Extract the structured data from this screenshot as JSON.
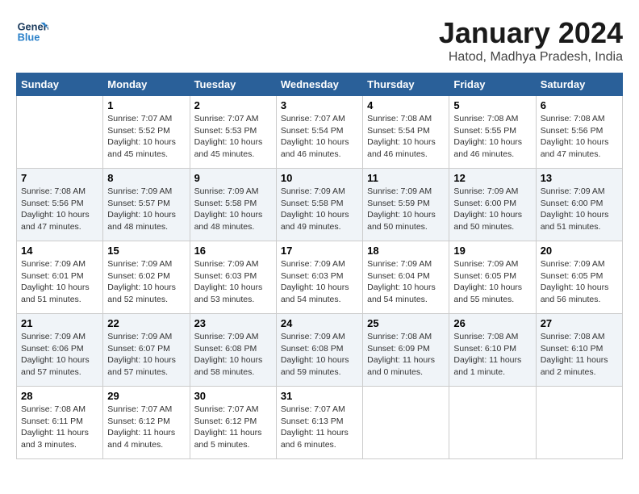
{
  "header": {
    "logo_line1": "General",
    "logo_line2": "Blue",
    "month_title": "January 2024",
    "location": "Hatod, Madhya Pradesh, India"
  },
  "days_of_week": [
    "Sunday",
    "Monday",
    "Tuesday",
    "Wednesday",
    "Thursday",
    "Friday",
    "Saturday"
  ],
  "weeks": [
    [
      {
        "day": "",
        "info": ""
      },
      {
        "day": "1",
        "info": "Sunrise: 7:07 AM\nSunset: 5:52 PM\nDaylight: 10 hours\nand 45 minutes."
      },
      {
        "day": "2",
        "info": "Sunrise: 7:07 AM\nSunset: 5:53 PM\nDaylight: 10 hours\nand 45 minutes."
      },
      {
        "day": "3",
        "info": "Sunrise: 7:07 AM\nSunset: 5:54 PM\nDaylight: 10 hours\nand 46 minutes."
      },
      {
        "day": "4",
        "info": "Sunrise: 7:08 AM\nSunset: 5:54 PM\nDaylight: 10 hours\nand 46 minutes."
      },
      {
        "day": "5",
        "info": "Sunrise: 7:08 AM\nSunset: 5:55 PM\nDaylight: 10 hours\nand 46 minutes."
      },
      {
        "day": "6",
        "info": "Sunrise: 7:08 AM\nSunset: 5:56 PM\nDaylight: 10 hours\nand 47 minutes."
      }
    ],
    [
      {
        "day": "7",
        "info": "Sunrise: 7:08 AM\nSunset: 5:56 PM\nDaylight: 10 hours\nand 47 minutes."
      },
      {
        "day": "8",
        "info": "Sunrise: 7:09 AM\nSunset: 5:57 PM\nDaylight: 10 hours\nand 48 minutes."
      },
      {
        "day": "9",
        "info": "Sunrise: 7:09 AM\nSunset: 5:58 PM\nDaylight: 10 hours\nand 48 minutes."
      },
      {
        "day": "10",
        "info": "Sunrise: 7:09 AM\nSunset: 5:58 PM\nDaylight: 10 hours\nand 49 minutes."
      },
      {
        "day": "11",
        "info": "Sunrise: 7:09 AM\nSunset: 5:59 PM\nDaylight: 10 hours\nand 50 minutes."
      },
      {
        "day": "12",
        "info": "Sunrise: 7:09 AM\nSunset: 6:00 PM\nDaylight: 10 hours\nand 50 minutes."
      },
      {
        "day": "13",
        "info": "Sunrise: 7:09 AM\nSunset: 6:00 PM\nDaylight: 10 hours\nand 51 minutes."
      }
    ],
    [
      {
        "day": "14",
        "info": "Sunrise: 7:09 AM\nSunset: 6:01 PM\nDaylight: 10 hours\nand 51 minutes."
      },
      {
        "day": "15",
        "info": "Sunrise: 7:09 AM\nSunset: 6:02 PM\nDaylight: 10 hours\nand 52 minutes."
      },
      {
        "day": "16",
        "info": "Sunrise: 7:09 AM\nSunset: 6:03 PM\nDaylight: 10 hours\nand 53 minutes."
      },
      {
        "day": "17",
        "info": "Sunrise: 7:09 AM\nSunset: 6:03 PM\nDaylight: 10 hours\nand 54 minutes."
      },
      {
        "day": "18",
        "info": "Sunrise: 7:09 AM\nSunset: 6:04 PM\nDaylight: 10 hours\nand 54 minutes."
      },
      {
        "day": "19",
        "info": "Sunrise: 7:09 AM\nSunset: 6:05 PM\nDaylight: 10 hours\nand 55 minutes."
      },
      {
        "day": "20",
        "info": "Sunrise: 7:09 AM\nSunset: 6:05 PM\nDaylight: 10 hours\nand 56 minutes."
      }
    ],
    [
      {
        "day": "21",
        "info": "Sunrise: 7:09 AM\nSunset: 6:06 PM\nDaylight: 10 hours\nand 57 minutes."
      },
      {
        "day": "22",
        "info": "Sunrise: 7:09 AM\nSunset: 6:07 PM\nDaylight: 10 hours\nand 57 minutes."
      },
      {
        "day": "23",
        "info": "Sunrise: 7:09 AM\nSunset: 6:08 PM\nDaylight: 10 hours\nand 58 minutes."
      },
      {
        "day": "24",
        "info": "Sunrise: 7:09 AM\nSunset: 6:08 PM\nDaylight: 10 hours\nand 59 minutes."
      },
      {
        "day": "25",
        "info": "Sunrise: 7:08 AM\nSunset: 6:09 PM\nDaylight: 11 hours\nand 0 minutes."
      },
      {
        "day": "26",
        "info": "Sunrise: 7:08 AM\nSunset: 6:10 PM\nDaylight: 11 hours\nand 1 minute."
      },
      {
        "day": "27",
        "info": "Sunrise: 7:08 AM\nSunset: 6:10 PM\nDaylight: 11 hours\nand 2 minutes."
      }
    ],
    [
      {
        "day": "28",
        "info": "Sunrise: 7:08 AM\nSunset: 6:11 PM\nDaylight: 11 hours\nand 3 minutes."
      },
      {
        "day": "29",
        "info": "Sunrise: 7:07 AM\nSunset: 6:12 PM\nDaylight: 11 hours\nand 4 minutes."
      },
      {
        "day": "30",
        "info": "Sunrise: 7:07 AM\nSunset: 6:12 PM\nDaylight: 11 hours\nand 5 minutes."
      },
      {
        "day": "31",
        "info": "Sunrise: 7:07 AM\nSunset: 6:13 PM\nDaylight: 11 hours\nand 6 minutes."
      },
      {
        "day": "",
        "info": ""
      },
      {
        "day": "",
        "info": ""
      },
      {
        "day": "",
        "info": ""
      }
    ]
  ]
}
